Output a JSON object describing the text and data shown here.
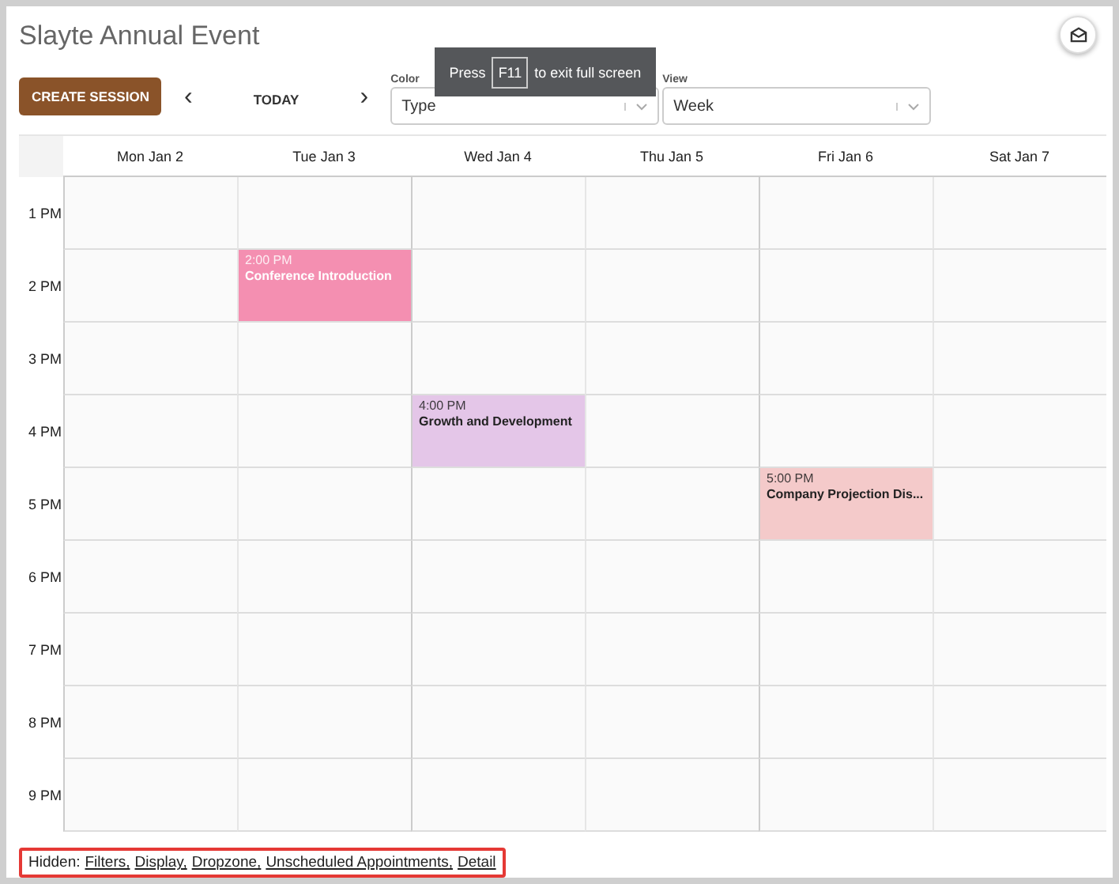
{
  "title": "Slayte Annual Event",
  "toolbar": {
    "create_button": "CREATE SESSION",
    "prev": "‹",
    "today": "TODAY",
    "next": "›",
    "color_field": {
      "label": "Color",
      "value": "Type"
    },
    "view_field": {
      "label": "View",
      "value": "Week"
    }
  },
  "toast": {
    "before": "Press",
    "key": "F11",
    "after": "to exit full screen"
  },
  "calendar": {
    "days": [
      "Mon Jan 2",
      "Tue Jan 3",
      "Wed Jan 4",
      "Thu Jan 5",
      "Fri Jan 6",
      "Sat Jan 7"
    ],
    "rows": [
      {
        "hour": "1 PM",
        "cells": [
          null,
          null,
          null,
          null,
          null,
          null
        ]
      },
      {
        "hour": "2 PM",
        "cells": [
          null,
          {
            "time": "2:00 PM",
            "title": "Conference Introduction",
            "color": "#f48fb1",
            "light_text": true
          },
          null,
          null,
          null,
          null
        ]
      },
      {
        "hour": "3 PM",
        "cells": [
          null,
          null,
          null,
          null,
          null,
          null
        ]
      },
      {
        "hour": "4 PM",
        "cells": [
          null,
          null,
          {
            "time": "4:00 PM",
            "title": "Growth and Development",
            "color": "#e4c6e8",
            "light_text": false
          },
          null,
          null,
          null
        ]
      },
      {
        "hour": "5 PM",
        "cells": [
          null,
          null,
          null,
          null,
          {
            "time": "5:00 PM",
            "title": "Company Projection Dis...",
            "color": "#f4caca",
            "light_text": false
          },
          null
        ]
      },
      {
        "hour": "6 PM",
        "cells": [
          null,
          null,
          null,
          null,
          null,
          null
        ]
      },
      {
        "hour": "7 PM",
        "cells": [
          null,
          null,
          null,
          null,
          null,
          null
        ]
      },
      {
        "hour": "8 PM",
        "cells": [
          null,
          null,
          null,
          null,
          null,
          null
        ]
      },
      {
        "hour": "9 PM",
        "cells": [
          null,
          null,
          null,
          null,
          null,
          null
        ]
      }
    ]
  },
  "footer": {
    "label": "Hidden:",
    "links": [
      "Filters,",
      "Display,",
      "Dropzone,",
      "Unscheduled Appointments,",
      "Detail"
    ]
  }
}
